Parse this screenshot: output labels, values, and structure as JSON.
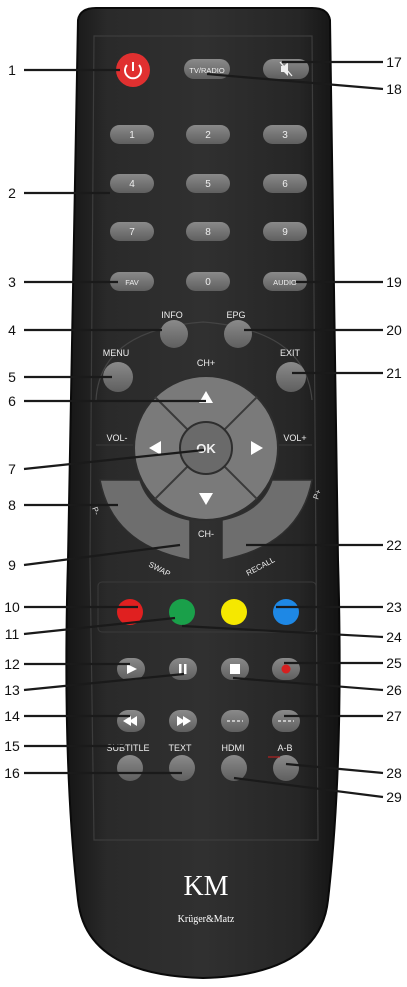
{
  "remote": {
    "buttons": {
      "tv_radio": "TV/RADIO",
      "digits": [
        "1",
        "2",
        "3",
        "4",
        "5",
        "6",
        "7",
        "8",
        "9"
      ],
      "fav": "FAV",
      "zero": "0",
      "audio": "AUDIO",
      "info": "INFO",
      "epg": "EPG",
      "menu": "MENU",
      "exit": "EXIT",
      "ch_plus": "CH+",
      "ch_minus": "CH-",
      "vol_minus": "VOL-",
      "vol_plus": "VOL+",
      "ok": "OK",
      "p_minus": "P-",
      "p_plus": "P+",
      "swap": "SWAP",
      "recall": "RECALL",
      "subtitle": "SUBTITLE",
      "text": "TEXT",
      "hdmi": "HDMI",
      "ab": "A-B"
    },
    "color_keys": [
      "#e02020",
      "#1aa04a",
      "#f5e800",
      "#1e88e5"
    ],
    "power_color": "#e03030",
    "brand": {
      "logo": "KM",
      "name": "Krüger&Matz"
    }
  },
  "callouts": {
    "left": [
      "1",
      "2",
      "3",
      "4",
      "5",
      "6",
      "7",
      "8",
      "9",
      "10",
      "11",
      "12",
      "13",
      "14",
      "15",
      "16"
    ],
    "right": [
      "17",
      "18",
      "19",
      "20",
      "21",
      "22",
      "23",
      "24",
      "25",
      "26",
      "27",
      "28",
      "29"
    ]
  }
}
